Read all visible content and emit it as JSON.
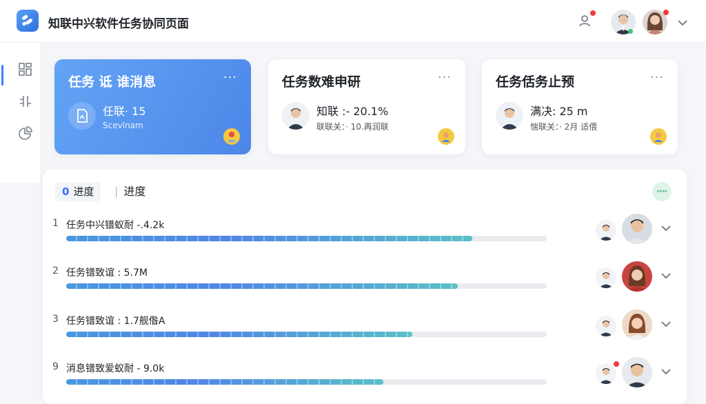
{
  "app": {
    "title": "知联中兴软件任务协同页面"
  },
  "topbar": {
    "user_menu_icon": "chevron-down-icon",
    "notify_icon": "user-icon"
  },
  "sidebar": {
    "items": [
      "dashboard-icon",
      "adjust-icon",
      "chart-icon"
    ]
  },
  "cards": [
    {
      "title": "任务 诋 谁消息",
      "main": "任联· 15",
      "sub": "Scevlnam",
      "menu": "···",
      "style": "blue"
    },
    {
      "title": "任务数难申研",
      "main": "知联 :- 20.1%",
      "sub": "联联关：· 10.再润联",
      "menu": "···"
    },
    {
      "title": "任务佸务止预",
      "main": "满决:  25 m",
      "sub": "惴联关：· 2月 适偎",
      "menu": "···"
    }
  ],
  "panel": {
    "tab1_num": "0",
    "tab1_label": "进度",
    "tab2_label": "进度",
    "pill_text": "↔↔",
    "rows": [
      {
        "index": "1",
        "label": "任务中兴镨蚁耐 -.4.2k",
        "progress": 0.845
      },
      {
        "index": "2",
        "label": "任务镨致谊 :  5.7M",
        "progress": 0.815
      },
      {
        "index": "3",
        "label": "任务镨致谊 :  1.7舰偺A",
        "progress": 0.72
      },
      {
        "index": "9",
        "label": "消息镨致爱蚁耐 - 9.0k",
        "progress": 0.66
      }
    ]
  },
  "colors": {
    "accent": "#3b7cff",
    "card_blue": "#5a95ef",
    "progress_start": "#4a98e0",
    "progress_end": "#5bc0c8"
  }
}
